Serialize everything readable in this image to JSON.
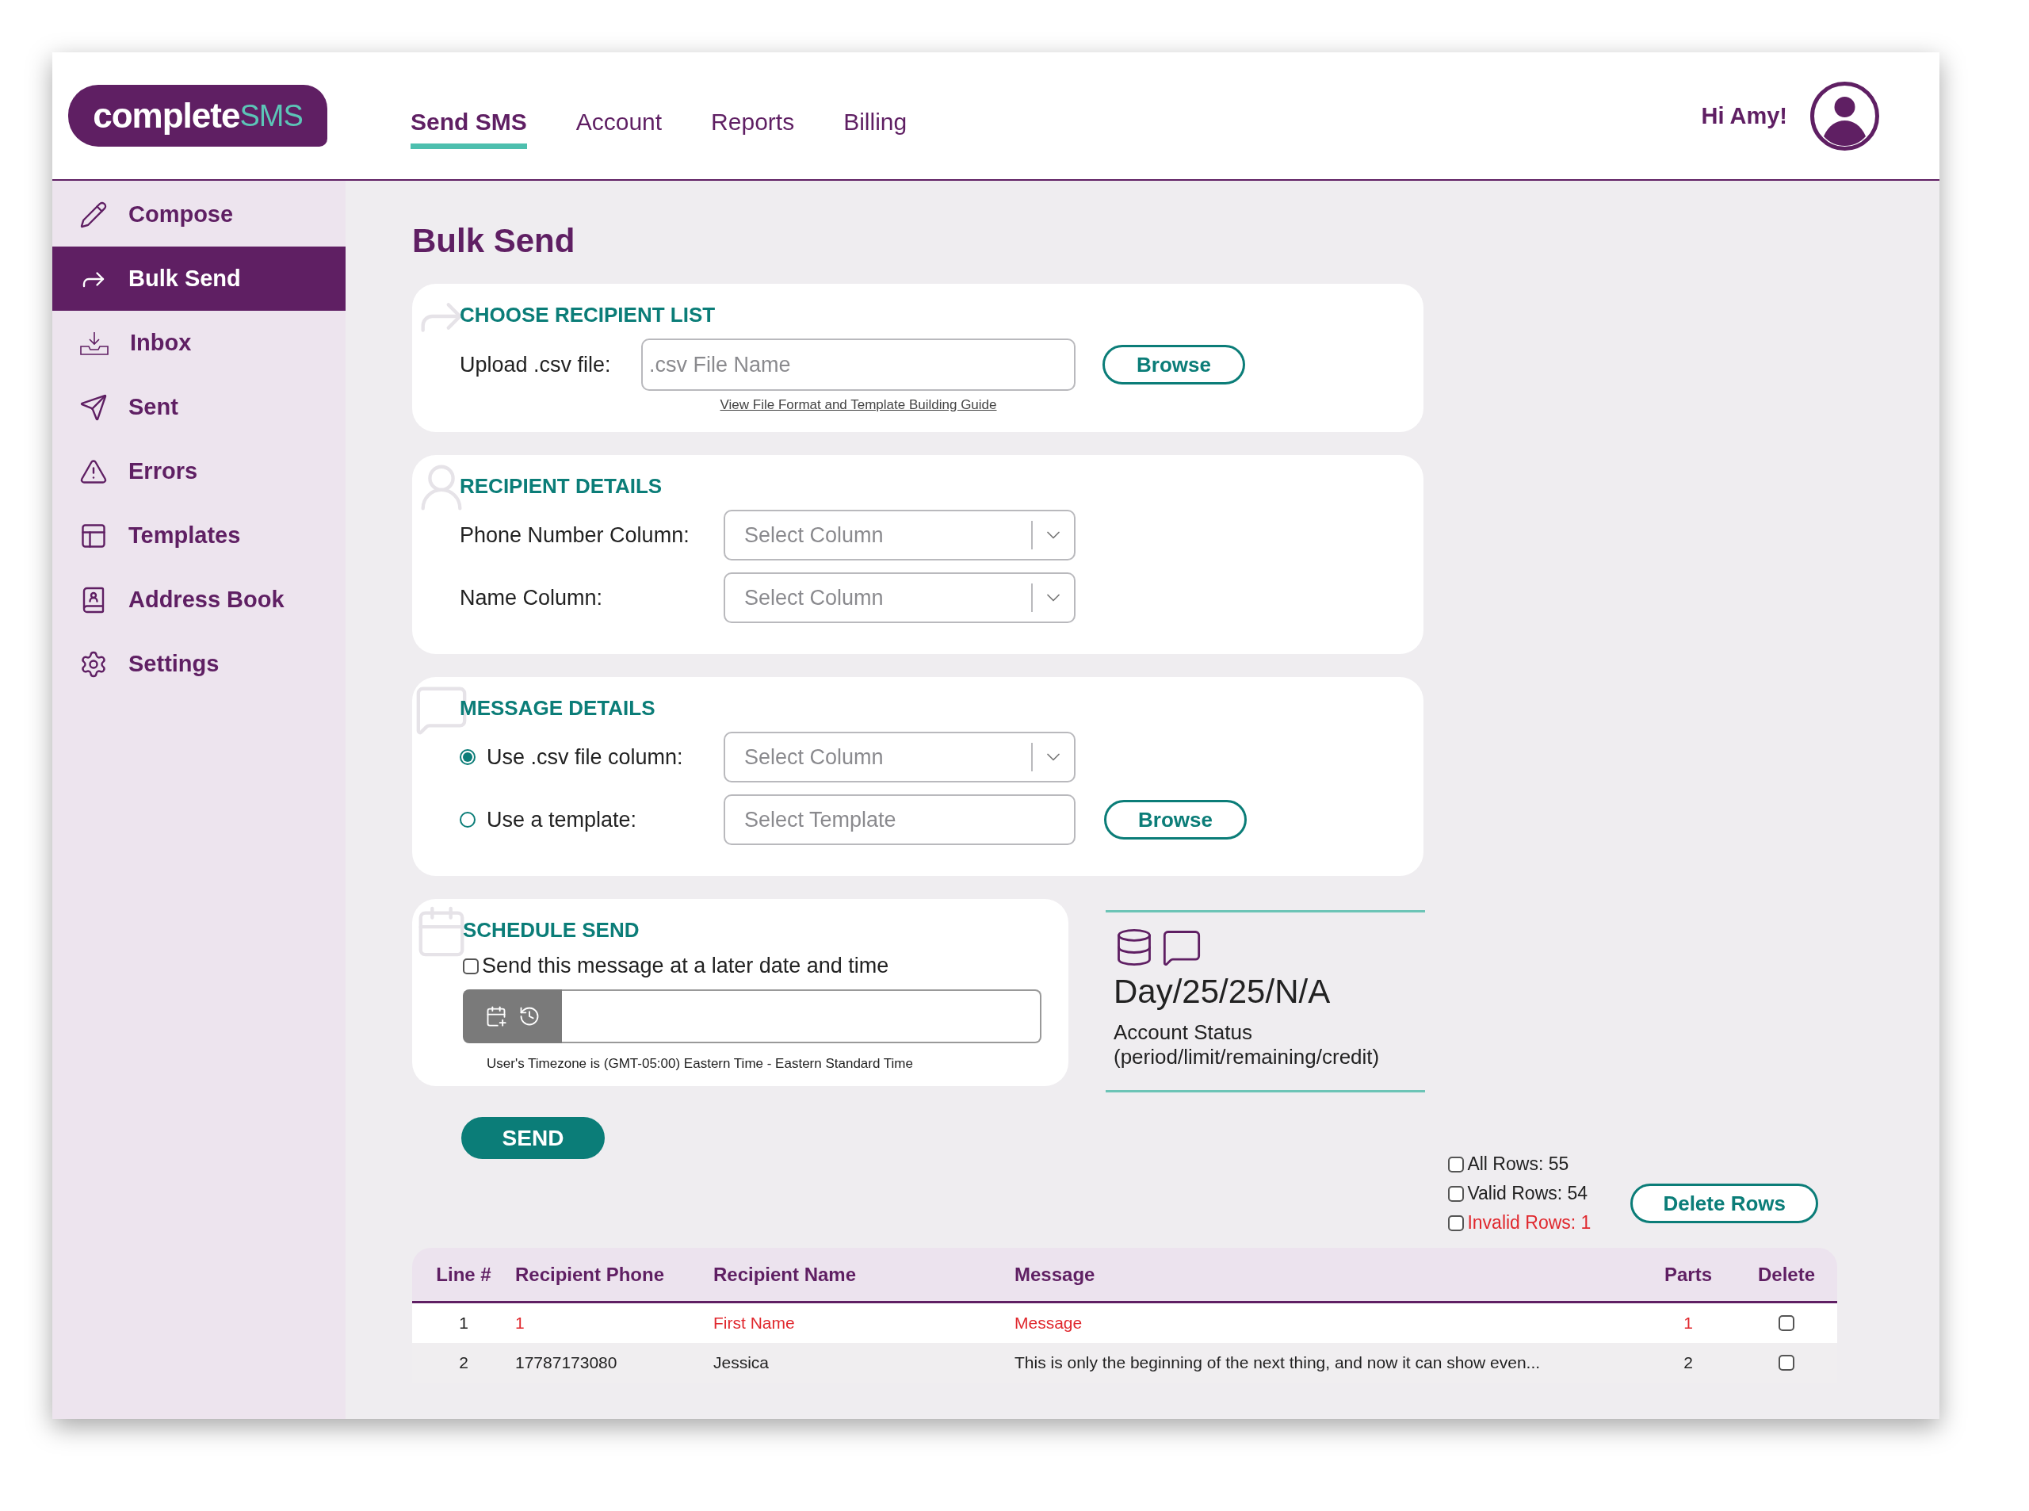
{
  "header": {
    "logo": {
      "main": "complete",
      "accent": "SMS"
    },
    "nav": [
      {
        "label": "Send SMS",
        "selected": true
      },
      {
        "label": "Account",
        "selected": false
      },
      {
        "label": "Reports",
        "selected": false
      },
      {
        "label": "Billing",
        "selected": false
      }
    ],
    "greeting": "Hi Amy!"
  },
  "sidebar": {
    "items": [
      {
        "label": "Compose",
        "selected": false
      },
      {
        "label": "Bulk Send",
        "selected": true
      },
      {
        "label": "Inbox",
        "selected": false
      },
      {
        "label": "Sent",
        "selected": false
      },
      {
        "label": "Errors",
        "selected": false
      },
      {
        "label": "Templates",
        "selected": false
      },
      {
        "label": "Address Book",
        "selected": false
      },
      {
        "label": "Settings",
        "selected": false
      }
    ]
  },
  "page_title": "Bulk Send",
  "recipient_list": {
    "title": "CHOOSE RECIPIENT LIST",
    "label": "Upload .csv file:",
    "placeholder": ".csv File Name",
    "button": "Browse",
    "link": "View File Format and Template Building Guide"
  },
  "recipient_details": {
    "title": "RECIPIENT DETAILS",
    "fields": [
      {
        "label": "Phone Number Column:",
        "placeholder": "Select Column"
      },
      {
        "label": "Name Column:",
        "placeholder": "Select Column"
      }
    ]
  },
  "message_details": {
    "title": "MESSAGE DETAILS",
    "options": [
      {
        "label": "Use .csv file column:",
        "selected": true,
        "kind": "select",
        "placeholder": "Select Column"
      },
      {
        "label": "Use a template:",
        "selected": false,
        "kind": "text",
        "placeholder": "Select Template"
      }
    ],
    "button": "Browse"
  },
  "schedule": {
    "title": "SCHEDULE SEND",
    "checkbox": {
      "label": "Send this message at a later date and time",
      "checked": false
    },
    "timezone": "User's Timezone is (GMT-05:00) Eastern Time - Eastern Standard Time"
  },
  "account_status": {
    "value": "Day/25/25/N/A",
    "label": "Account Status",
    "sublabel": "(period/limit/remaining/credit)"
  },
  "send_button": "SEND",
  "row_filters": [
    {
      "label": "All Rows: 55",
      "checked": false,
      "error": false
    },
    {
      "label": "Valid Rows: 54",
      "checked": false,
      "error": false
    },
    {
      "label": "Invalid Rows: 1",
      "checked": false,
      "error": true
    }
  ],
  "delete_rows_button": "Delete Rows",
  "table": {
    "columns": [
      "Line #",
      "Recipient Phone",
      "Recipient Name",
      "Message",
      "Parts",
      "Delete"
    ],
    "rows": [
      {
        "valid": false,
        "cells": [
          "1",
          "1",
          "First Name",
          "Message",
          "1"
        ],
        "checked": false
      },
      {
        "valid": true,
        "cells": [
          "2",
          "17787173080",
          "Jessica",
          "This is only the beginning of the next thing, and now it can show even...",
          "2"
        ],
        "checked": false
      }
    ]
  }
}
